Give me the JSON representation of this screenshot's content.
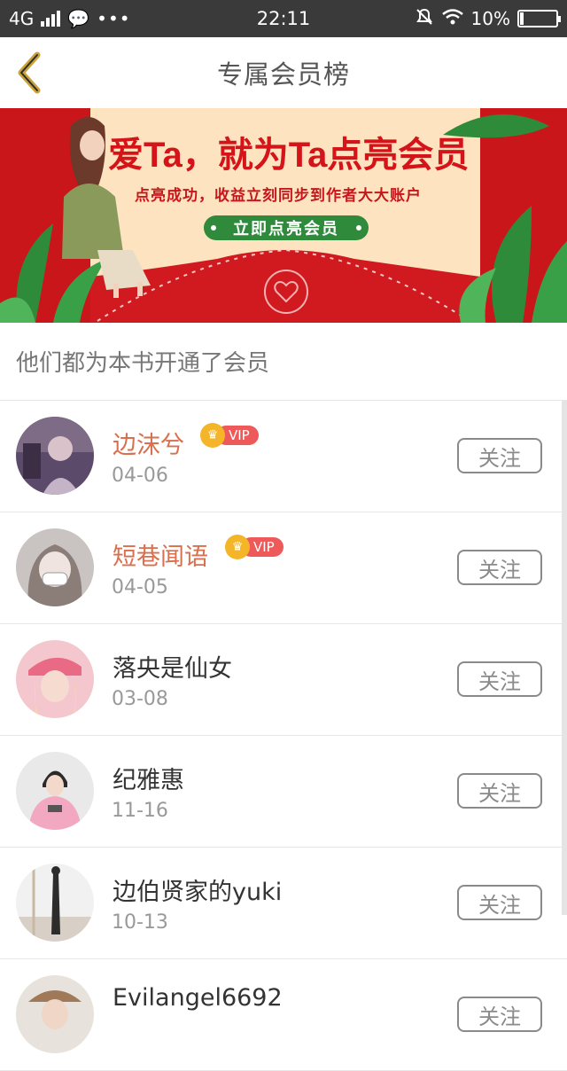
{
  "status_bar": {
    "network": "4G",
    "time": "22:11",
    "battery": "10%",
    "battery_level": 0.1
  },
  "nav": {
    "title": "专属会员榜"
  },
  "banner": {
    "headline": "爱Ta，就为Ta点亮会员",
    "subtitle": "点亮成功，收益立刻同步到作者大大账户",
    "button_label": "立即点亮会员"
  },
  "section_title": "他们都为本书开通了会员",
  "follow_label": "关注",
  "members": [
    {
      "name": "边沫兮",
      "date": "04-06",
      "vip": true,
      "vip_label": "VIP"
    },
    {
      "name": "短巷闻语",
      "date": "04-05",
      "vip": true,
      "vip_label": "VIP"
    },
    {
      "name": "落央是仙女",
      "date": "03-08",
      "vip": false
    },
    {
      "name": "纪雅惠",
      "date": "11-16",
      "vip": false
    },
    {
      "name": "边伯贤家的yuki",
      "date": "10-13",
      "vip": false
    },
    {
      "name": "Evilangel6692",
      "date": "",
      "vip": false
    }
  ],
  "colors": {
    "accent_vip_name": "#d86f4e",
    "vip_pill": "#ee5a5a",
    "banner_red": "#c9161b",
    "banner_button": "#2f8a3b"
  }
}
